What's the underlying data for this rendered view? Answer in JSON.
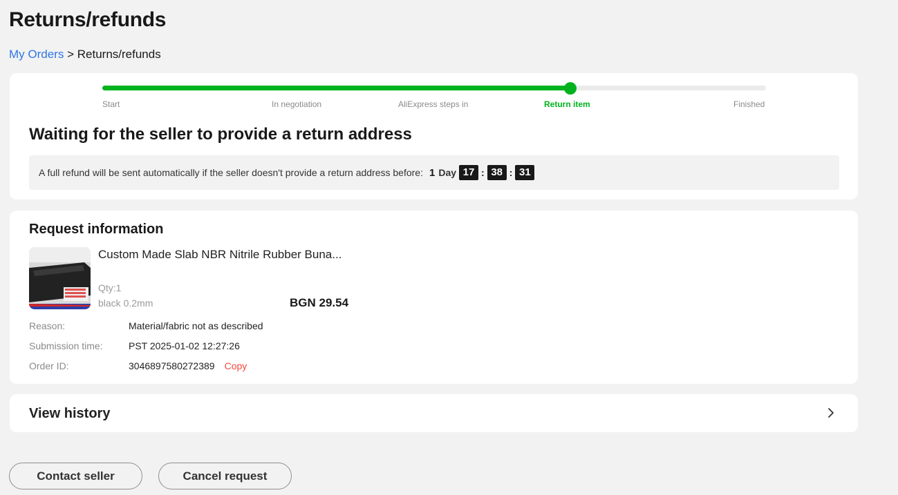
{
  "page": {
    "title": "Returns/refunds"
  },
  "breadcrumb": {
    "link": "My Orders",
    "separator": ">",
    "current": "Returns/refunds"
  },
  "progress": {
    "steps": [
      "Start",
      "In negotiation",
      "AliExpress steps in",
      "Return item",
      "Finished"
    ],
    "active_step": "Return item",
    "completed_fraction": 0.705,
    "accent_color": "#00b31e"
  },
  "status": {
    "title": "Waiting for the seller to provide a return address",
    "notice": "A full refund will be sent automatically if the seller doesn't provide a return address before:",
    "countdown": {
      "days": "1",
      "day_label": "Day",
      "hours": "17",
      "minutes": "38",
      "seconds": "31",
      "separator": ":"
    }
  },
  "request": {
    "title": "Request information",
    "product": {
      "name": "Custom Made Slab NBR Nitrile Rubber Buna...",
      "qty": "Qty:1",
      "sku": "black 0.2mm",
      "price": "BGN 29.54",
      "image_icon": "rubber-sheet-product-image"
    },
    "fields": [
      {
        "label": "Reason:",
        "value": "Material/fabric not as described"
      },
      {
        "label": "Submission time:",
        "value": "PST 2025-01-02 12:27:26"
      },
      {
        "label": "Order ID:",
        "value": "3046897580272389"
      }
    ],
    "copy_label": "Copy"
  },
  "history": {
    "label": "View history",
    "icon": "chevron-right-icon"
  },
  "actions": {
    "contact_seller": "Contact seller",
    "cancel_request": "Cancel request"
  },
  "colors": {
    "link": "#2e76e6",
    "accent": "#00b31e",
    "copy": "#f5483b"
  }
}
